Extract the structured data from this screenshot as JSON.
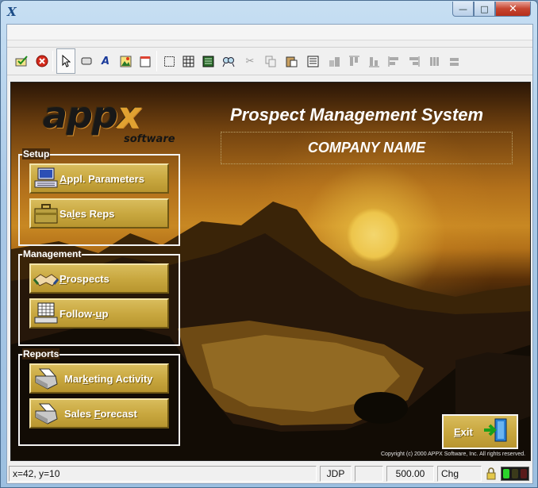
{
  "window": {
    "app_icon": "X",
    "minimize": "—",
    "maximize": "□",
    "close": "✕"
  },
  "toolbar": {
    "icons": [
      "ok-icon",
      "cancel-icon",
      "pointer-icon",
      "button-icon",
      "text-icon",
      "image-icon",
      "note-icon",
      "frame-icon",
      "grid-icon",
      "list-icon",
      "find-icon",
      "cut-icon",
      "copy-icon",
      "paste-icon",
      "properties-icon",
      "align-icon",
      "align-top-icon",
      "align-bottom-icon",
      "align-left-icon",
      "align-right-icon",
      "spacing-icon",
      "size-icon"
    ]
  },
  "header": {
    "logo_main": "app",
    "logo_x": "x",
    "logo_sub": "software",
    "system_title": "Prospect Management System",
    "company_name": "COMPANY NAME"
  },
  "groups": [
    {
      "label": "Setup",
      "buttons": [
        {
          "pre": "",
          "key": "A",
          "post": "ppl. Parameters",
          "icon": "computer-icon"
        },
        {
          "pre": "Sa",
          "key": "l",
          "post": "es Reps",
          "icon": "briefcase-icon"
        }
      ]
    },
    {
      "label": "Management",
      "buttons": [
        {
          "pre": "",
          "key": "P",
          "post": "rospects",
          "icon": "handshake-icon"
        },
        {
          "pre": "Follow-",
          "key": "u",
          "post": "p",
          "icon": "calendar-icon"
        }
      ]
    },
    {
      "label": "Reports",
      "buttons": [
        {
          "pre": "Mar",
          "key": "k",
          "post": "eting Activity",
          "icon": "printer-icon"
        },
        {
          "pre": "Sales ",
          "key": "F",
          "post": "orecast",
          "icon": "printer-icon"
        }
      ]
    }
  ],
  "exit": {
    "pre": "",
    "key": "E",
    "post": "xit",
    "icon": "exit-door-icon"
  },
  "copyright": "Copyright (c) 2000 APPX Software, Inc.  All rights reserved.",
  "status": {
    "coords": "x=42, y=10",
    "user": "JDP",
    "value": "500.00",
    "mode": "Chg"
  },
  "colors": {
    "button_gold": "#c9a840",
    "sun": "#edc54b"
  }
}
